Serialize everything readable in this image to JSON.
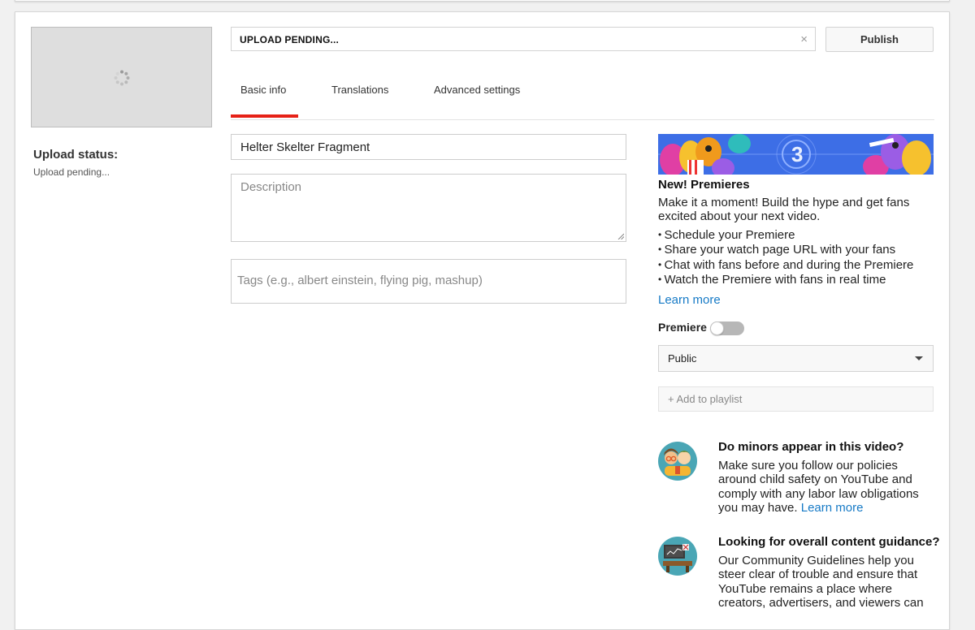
{
  "upload": {
    "status_label": "Upload status:",
    "status_value": "Upload pending...",
    "progress_text": "UPLOAD PENDING...",
    "close_symbol": "×"
  },
  "toolbar": {
    "publish_label": "Publish"
  },
  "tabs": [
    {
      "label": "Basic info",
      "active": true
    },
    {
      "label": "Translations",
      "active": false
    },
    {
      "label": "Advanced settings",
      "active": false
    }
  ],
  "form": {
    "title_value": "Helter Skelter Fragment",
    "description_placeholder": "Description",
    "tags_placeholder": "Tags (e.g., albert einstein, flying pig, mashup)"
  },
  "premieres": {
    "title": "New! Premieres",
    "body": "Make it a moment! Build the hype and get fans excited about your next video.",
    "bullets": [
      "Schedule your Premiere",
      "Share your watch page URL with your fans",
      "Chat with fans before and during the Premiere",
      "Watch the Premiere with fans in real time"
    ],
    "learn_more": "Learn more",
    "countdown_number": "3",
    "toggle_label": "Premiere",
    "toggle_on": false
  },
  "privacy": {
    "selected": "Public"
  },
  "playlist": {
    "label": "+ Add to playlist"
  },
  "minors": {
    "title": "Do minors appear in this video?",
    "body": "Make sure you follow our policies around child safety on YouTube and comply with any labor law obligations you may have.",
    "learn_more": "Learn more"
  },
  "guidance": {
    "title": "Looking for overall content guidance?",
    "body": "Our Community Guidelines help you steer clear of trouble and ensure that YouTube remains a place where creators, advertisers, and viewers can"
  },
  "colors": {
    "accent_red": "#e62117",
    "link_blue": "#167ac6",
    "banner_blue": "#3d6ee6",
    "icon_teal": "#4aa6b5"
  },
  "icons": {
    "spinner": "loading-spinner-icon",
    "minors": "kids-illustration-icon",
    "guidance": "presentation-illustration-icon",
    "select": "dropdown-arrow-icon"
  }
}
